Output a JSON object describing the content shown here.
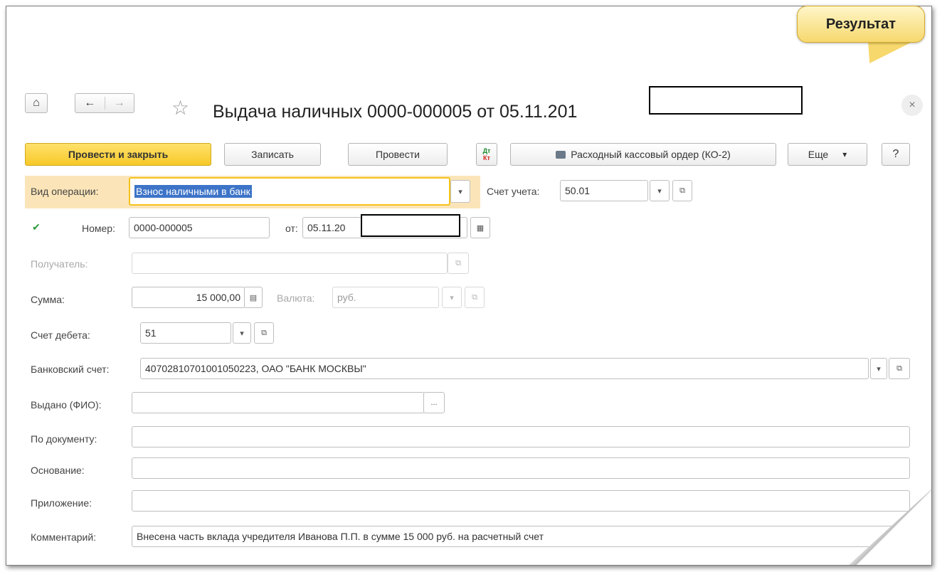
{
  "callout": {
    "label": "Результат"
  },
  "window": {
    "title": "Выдача наличных 0000-000005 от 05.11.201",
    "nav": {
      "home": "⌂",
      "back": "←",
      "forward": "→",
      "favorite": "☆",
      "close": "×"
    }
  },
  "toolbar": {
    "post_close": "Провести и закрыть",
    "save": "Записать",
    "post": "Провести",
    "dtkt_top": "Дт",
    "dtkt_bottom": "Кт",
    "print_order": "Расходный кассовый ордер (КО-2)",
    "more": "Еще",
    "more_arrow": "▾",
    "help": "?"
  },
  "form": {
    "operation": {
      "label": "Вид операции:",
      "value": "Взнос наличными в банк"
    },
    "account": {
      "label": "Счет учета:",
      "value": "50.01"
    },
    "number": {
      "label": "Номер:",
      "value": "0000-000005"
    },
    "date": {
      "label": "от:",
      "value": "05.11.20"
    },
    "recipient": {
      "label": "Получатель:",
      "value": ""
    },
    "amount": {
      "label": "Сумма:",
      "value": "15 000,00"
    },
    "currency": {
      "label": "Валюта:",
      "value": "руб."
    },
    "debit_account": {
      "label": "Счет дебета:",
      "value": "51"
    },
    "bank_account": {
      "label": "Банковский счет:",
      "value": "40702810701001050223, ОАО \"БАНК МОСКВЫ\""
    },
    "issued_to": {
      "label": "Выдано (ФИО):",
      "value": "",
      "picker": "..."
    },
    "by_document": {
      "label": "По документу:",
      "value": ""
    },
    "basis": {
      "label": "Основание:",
      "value": ""
    },
    "attachment": {
      "label": "Приложение:",
      "value": ""
    },
    "comment": {
      "label": "Комментарий:",
      "value": "Внесена часть вклада учредителя Иванова П.П. в сумме 15 000 руб. на расчетный счет"
    }
  },
  "icons": {
    "dropdown": "▾",
    "open": "⧉",
    "calendar": "▦",
    "calculator": "▤",
    "posted": "✔"
  }
}
